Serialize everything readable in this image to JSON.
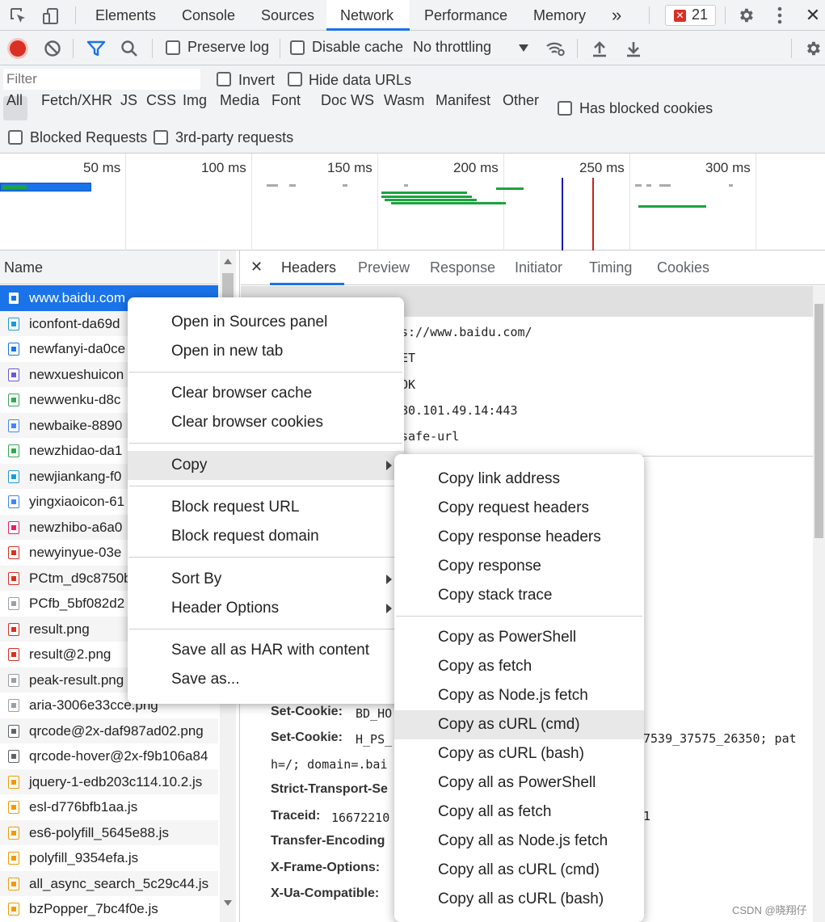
{
  "tabs": {
    "elements": "Elements",
    "console": "Console",
    "sources": "Sources",
    "network": "Network",
    "performance": "Performance",
    "memory": "Memory",
    "more": "»",
    "error_count": "21",
    "close": "✕"
  },
  "toolbar": {
    "preserve_log": "Preserve log",
    "disable_cache": "Disable cache",
    "throttling": "No throttling"
  },
  "filter": {
    "placeholder": "Filter",
    "invert": "Invert",
    "hide_data_urls": "Hide data URLs",
    "has_blocked_cookies": "Has blocked cookies",
    "blocked_requests": "Blocked Requests",
    "third_party": "3rd-party requests",
    "types": [
      "All",
      "Fetch/XHR",
      "JS",
      "CSS",
      "Img",
      "Media",
      "Font",
      "Doc",
      "WS",
      "Wasm",
      "Manifest",
      "Other"
    ]
  },
  "timeline": {
    "ticks": [
      "50 ms",
      "100 ms",
      "150 ms",
      "200 ms",
      "250 ms",
      "300 ms"
    ]
  },
  "name_header": "Name",
  "requests": [
    "www.baidu.com",
    "iconfont-da69d",
    "newfanyi-da0ce",
    "newxueshuicon",
    "newwenku-d8c",
    "newbaike-8890",
    "newzhidao-da1",
    "newjiankang-f0",
    "yingxiaoicon-61",
    "newzhibo-a6a0",
    "newyinyue-03e",
    "PCtm_d9c8750b",
    "PCfb_5bf082d2",
    "result.png",
    "result@2.png",
    "peak-result.png",
    "aria-3006e33cce.png",
    "qrcode@2x-daf987ad02.png",
    "qrcode-hover@2x-f9b106a84",
    "jquery-1-edb203c114.10.2.js",
    "esl-d776bfb1aa.js",
    "es6-polyfill_5645e88.js",
    "polyfill_9354efa.js",
    "all_async_search_5c29c44.js",
    "bzPopper_7bc4f0e.js"
  ],
  "detail": {
    "close": "✕",
    "tabs": [
      "Headers",
      "Preview",
      "Response",
      "Initiator",
      "Timing",
      "Cookies"
    ],
    "general_values": [
      "s://www.baidu.com/",
      "ET",
      " OK",
      "80.101.49.14:443",
      "safe-url"
    ],
    "headers": [
      {
        "name": "Set-Cookie:",
        "value": "BD_HO"
      },
      {
        "name": "Set-Cookie:",
        "value": "H_PS_"
      },
      {
        "name": "Strict-Transport-Se",
        "value": ""
      },
      {
        "name": "Traceid:",
        "value": "16672210"
      },
      {
        "name": "Transfer-Encoding",
        "value": ""
      },
      {
        "name": "X-Frame-Options:",
        "value": ""
      },
      {
        "name": "X-Ua-Compatible:",
        "value": ""
      }
    ],
    "cookie_tail": "7539_37575_26350; pat",
    "cookie_line2": "h=/; domain=.bai",
    "traceid_tail": "1"
  },
  "context_menu": {
    "open_sources": "Open in Sources panel",
    "open_tab": "Open in new tab",
    "clear_cache": "Clear browser cache",
    "clear_cookies": "Clear browser cookies",
    "copy": "Copy",
    "block_url": "Block request URL",
    "block_domain": "Block request domain",
    "sort_by": "Sort By",
    "header_options": "Header Options",
    "save_har": "Save all as HAR with content",
    "save_as": "Save as..."
  },
  "copy_submenu": [
    "Copy link address",
    "Copy request headers",
    "Copy response headers",
    "Copy response",
    "Copy stack trace",
    "Copy as PowerShell",
    "Copy as fetch",
    "Copy as Node.js fetch",
    "Copy as cURL (cmd)",
    "Copy as cURL (bash)",
    "Copy all as PowerShell",
    "Copy all as fetch",
    "Copy all as Node.js fetch",
    "Copy all as cURL (cmd)",
    "Copy all as cURL (bash)"
  ],
  "watermark": "CSDN @晓翔仔",
  "colors": {
    "accent": "#1a73e8",
    "record": "#d93025",
    "selected_row": "#1a73e8",
    "bar_green": "#1ba33f"
  }
}
